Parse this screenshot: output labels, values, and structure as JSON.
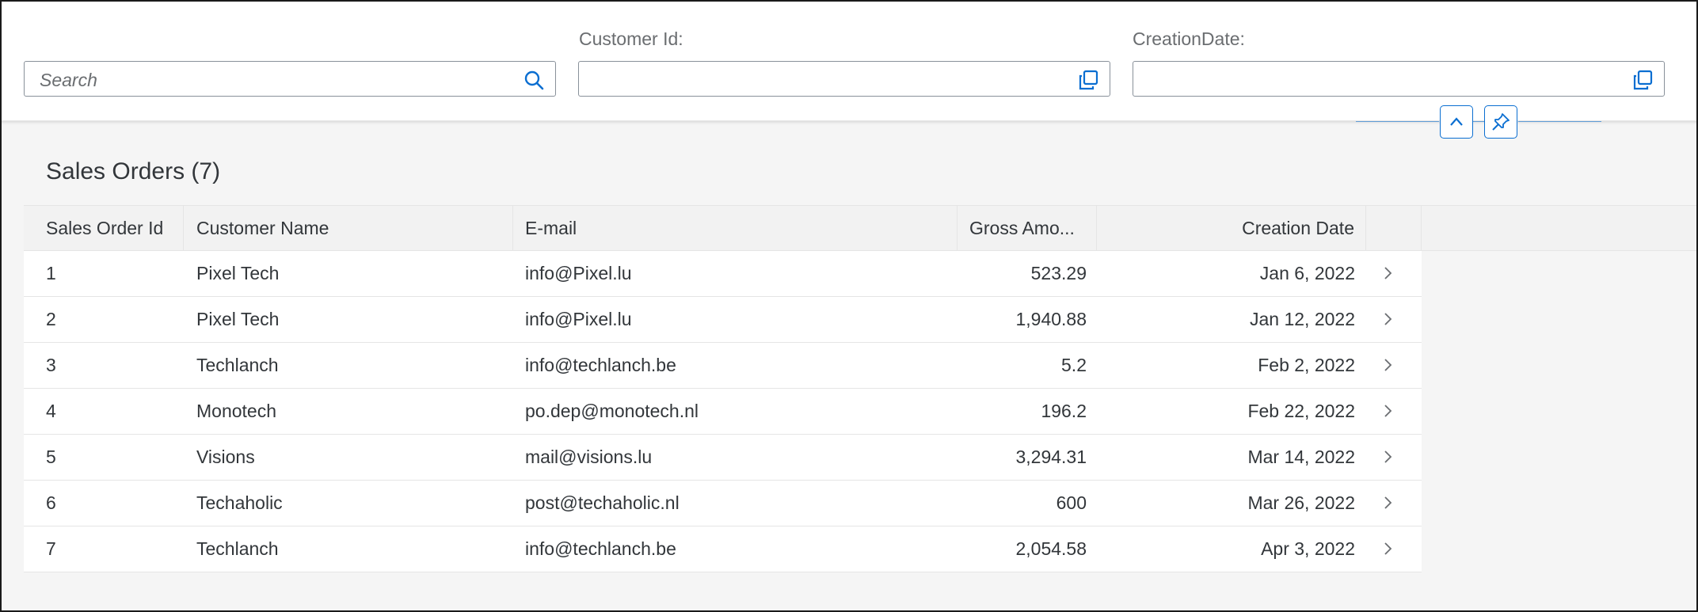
{
  "filter_bar": {
    "search": {
      "placeholder": "Search",
      "icon": "search-icon"
    },
    "fields": [
      {
        "label": "Customer Id:",
        "value": "",
        "icon": "value-help-icon"
      },
      {
        "label": "CreationDate:",
        "value": "",
        "icon": "value-help-icon"
      }
    ],
    "collapse_icon": "chevron-up-icon",
    "pin_icon": "pin-icon"
  },
  "table": {
    "title": "Sales Orders (7)",
    "columns": [
      "Sales Order Id",
      "Customer Name",
      "E-mail",
      "Gross Amo...",
      "Creation Date"
    ],
    "rows": [
      {
        "id": "1",
        "customer": "Pixel Tech",
        "email": "info@Pixel.lu",
        "amount": "523.29",
        "date": "Jan 6, 2022"
      },
      {
        "id": "2",
        "customer": "Pixel Tech",
        "email": "info@Pixel.lu",
        "amount": "1,940.88",
        "date": "Jan 12, 2022"
      },
      {
        "id": "3",
        "customer": "Techlanch",
        "email": "info@techlanch.be",
        "amount": "5.2",
        "date": "Feb 2, 2022"
      },
      {
        "id": "4",
        "customer": "Monotech",
        "email": "po.dep@monotech.nl",
        "amount": "196.2",
        "date": "Feb 22, 2022"
      },
      {
        "id": "5",
        "customer": "Visions",
        "email": "mail@visions.lu",
        "amount": "3,294.31",
        "date": "Mar 14, 2022"
      },
      {
        "id": "6",
        "customer": "Techaholic",
        "email": "post@techaholic.nl",
        "amount": "600",
        "date": "Mar 26, 2022"
      },
      {
        "id": "7",
        "customer": "Techlanch",
        "email": "info@techlanch.be",
        "amount": "2,054.58",
        "date": "Apr 3, 2022"
      }
    ],
    "row_nav_icon": "chevron-right-icon"
  },
  "colors": {
    "accent": "#0a6ed1",
    "text": "#32363a",
    "muted": "#6a6d70",
    "header_bg": "#f2f2f2",
    "page_bg": "#f5f5f5"
  }
}
